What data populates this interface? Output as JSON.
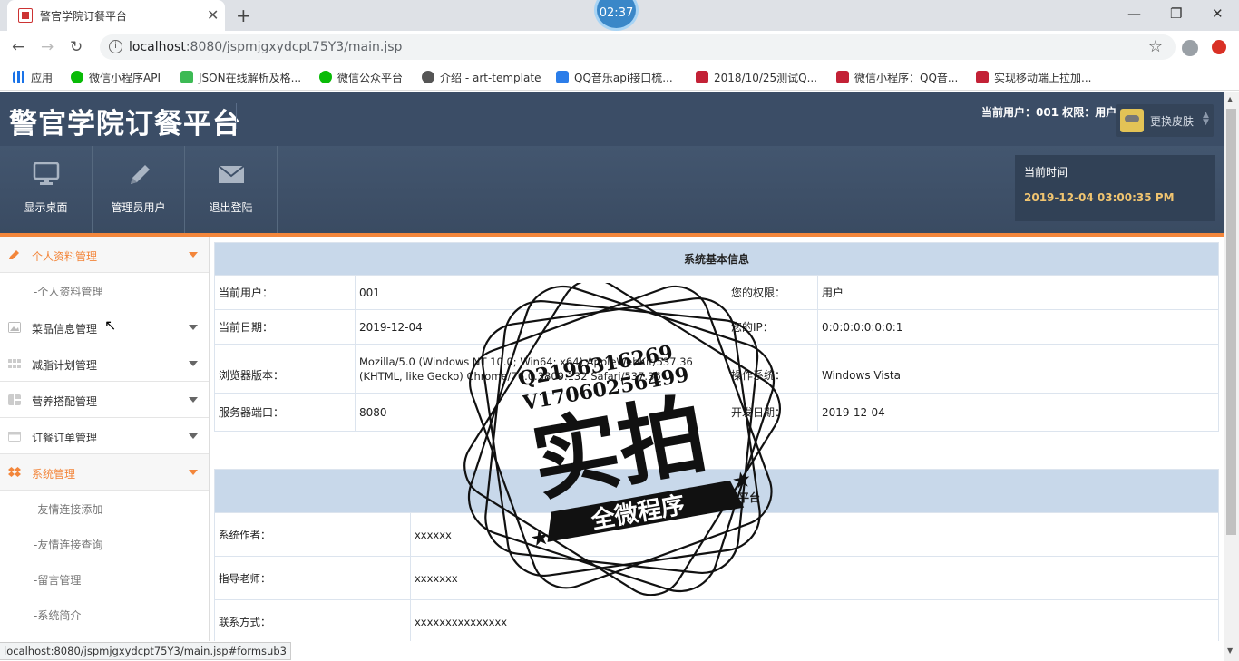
{
  "browser": {
    "tab_title": "警官学院订餐平台",
    "clock": "02:37",
    "url_host": "localhost",
    "url_rest": ":8080/jspmjgxydcpt75Y3/main.jsp",
    "status_url": "localhost:8080/jspmjgxydcpt75Y3/main.jsp#formsub3",
    "bookmarks": [
      {
        "label": "应用",
        "icon": "apps-icon",
        "color": "#1a73e8"
      },
      {
        "label": "微信小程序API",
        "icon": "wechat-icon",
        "color": "#09bb07"
      },
      {
        "label": "JSON在线解析及格...",
        "icon": "json-icon",
        "color": "#3cba54"
      },
      {
        "label": "微信公众平台",
        "icon": "wechat-icon",
        "color": "#09bb07"
      },
      {
        "label": "介绍 - art-template",
        "icon": "globe-icon",
        "color": "#555555"
      },
      {
        "label": "QQ音乐api接口梳...",
        "icon": "bookmark-icon",
        "color": "#2b7de9"
      },
      {
        "label": "2018/10/25测试Q...",
        "icon": "csdn-icon",
        "color": "#c32136"
      },
      {
        "label": "微信小程序：QQ音...",
        "icon": "csdn-icon",
        "color": "#c32136"
      },
      {
        "label": "实现移动端上拉加...",
        "icon": "csdn-icon",
        "color": "#c32136"
      }
    ]
  },
  "header": {
    "title": "警官学院订餐平台",
    "user_info": "当前用户：001 权限：用户",
    "skin_label": "更换皮肤"
  },
  "menubar": {
    "items": [
      {
        "label": "显示桌面",
        "icon": "monitor-icon"
      },
      {
        "label": "管理员用户",
        "icon": "pencil-icon"
      },
      {
        "label": "退出登陆",
        "icon": "envelope-icon"
      }
    ],
    "time_label": "当前时间",
    "time_value": "2019-12-04 03:00:35 PM"
  },
  "sidebar": {
    "groups": [
      {
        "label": "个人资料管理",
        "icon": "pencil-icon",
        "active": true,
        "subs": [
          "个人资料管理"
        ]
      },
      {
        "label": "菜品信息管理",
        "icon": "image-icon",
        "active": false,
        "subs": []
      },
      {
        "label": "减脂计划管理",
        "icon": "grid-icon",
        "active": false,
        "subs": []
      },
      {
        "label": "营养搭配管理",
        "icon": "layout-icon",
        "active": false,
        "subs": []
      },
      {
        "label": "订餐订单管理",
        "icon": "calendar-icon",
        "active": false,
        "subs": []
      },
      {
        "label": "系统管理",
        "icon": "dropbox-icon",
        "active": true,
        "subs": [
          "友情连接添加",
          "友情连接查询",
          "留言管理",
          "系统简介"
        ]
      }
    ]
  },
  "system_info": {
    "heading": "系统基本信息",
    "rows": [
      {
        "k1": "当前用户：",
        "v1": "001",
        "k2": "您的权限：",
        "v2": "用户"
      },
      {
        "k1": "当前日期：",
        "v1": "2019-12-04",
        "k2": "您的IP：",
        "v2": "0:0:0:0:0:0:0:1"
      },
      {
        "k1": "浏览器版本：",
        "v1": "Mozilla/5.0 (Windows NT 10.0; Win64; x64) AppleWebKit/537.36 (KHTML, like Gecko) Chrome/76.0.3809.132 Safari/537.36",
        "k2": "操作系统：",
        "v2": "Windows Vista"
      },
      {
        "k1": "服务器端口：",
        "v1": "8080",
        "k2": "开发日期：",
        "v2": "2019-12-04"
      }
    ]
  },
  "platform_info": {
    "heading": "警官学院订餐平台",
    "rows": [
      {
        "k": "系统作者：",
        "v": "xxxxxx"
      },
      {
        "k": "指导老师：",
        "v": "xxxxxxx"
      },
      {
        "k": "联系方式：",
        "v": "xxxxxxxxxxxxxxx"
      }
    ]
  },
  "watermark": {
    "line1": "Q2196316269",
    "line2": "V17060256499",
    "big": "实拍",
    "banner": "全微程序"
  }
}
